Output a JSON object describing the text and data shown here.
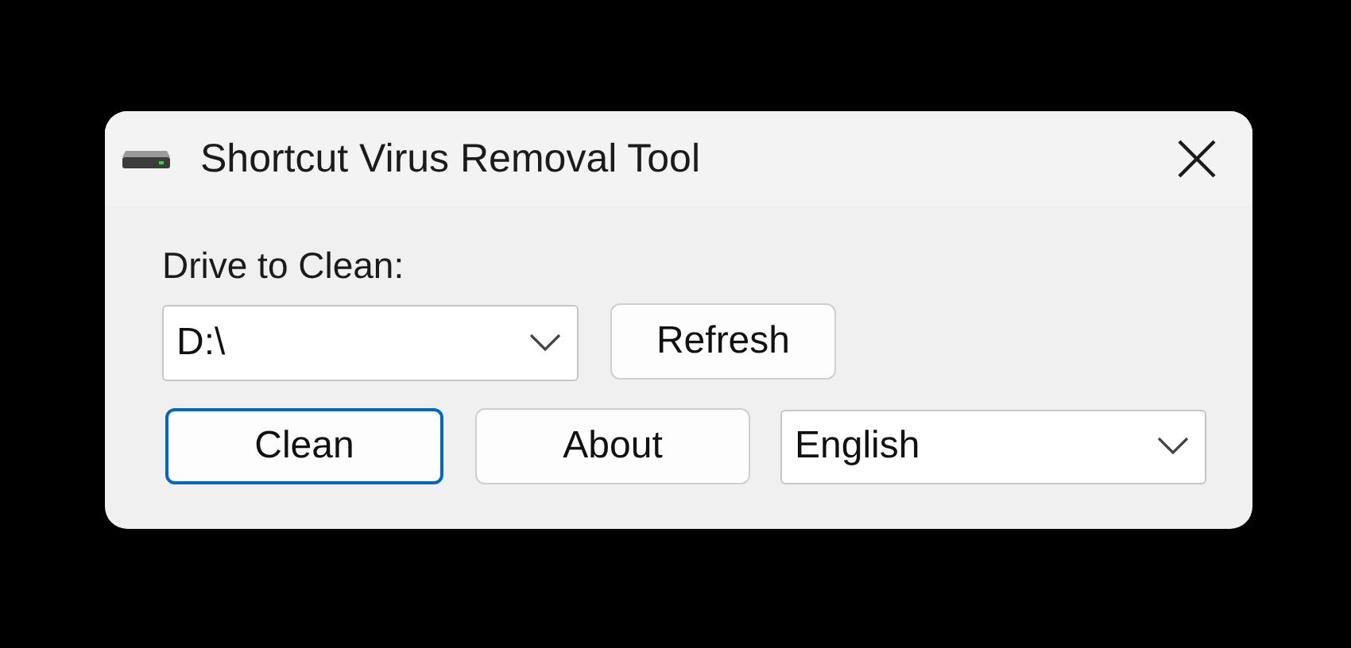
{
  "window": {
    "title": "Shortcut Virus Removal Tool"
  },
  "drive": {
    "label": "Drive to Clean:",
    "value": "D:\\"
  },
  "buttons": [
    {
      "label": "Refresh",
      "default": false
    },
    {
      "label": "Clean",
      "default": true
    },
    {
      "label": "About",
      "default": false
    }
  ],
  "language": {
    "value": "English"
  }
}
